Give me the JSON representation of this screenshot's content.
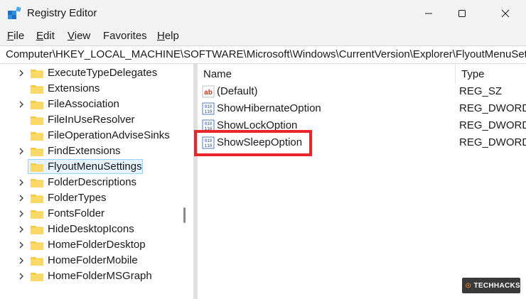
{
  "window": {
    "title": "Registry Editor",
    "app_icon": "registry-cubes-icon",
    "controls": [
      "minimize-icon",
      "maximize-icon",
      "close-icon"
    ]
  },
  "menu": [
    {
      "label": "File",
      "mnemonic": "F",
      "rest": "ile"
    },
    {
      "label": "Edit",
      "mnemonic": "E",
      "rest": "dit"
    },
    {
      "label": "View",
      "mnemonic": "V",
      "rest": "iew"
    },
    {
      "label": "Favorites",
      "mnemonic": "",
      "rest": "Favorites"
    },
    {
      "label": "Help",
      "mnemonic": "H",
      "rest": "elp"
    }
  ],
  "address": "Computer\\HKEY_LOCAL_MACHINE\\SOFTWARE\\Microsoft\\Windows\\CurrentVersion\\Explorer\\FlyoutMenuSettin",
  "tree": {
    "items": [
      {
        "label": "ExecuteTypeDelegates",
        "expandable": true
      },
      {
        "label": "Extensions",
        "expandable": false
      },
      {
        "label": "FileAssociation",
        "expandable": true
      },
      {
        "label": "FileInUseResolver",
        "expandable": false
      },
      {
        "label": "FileOperationAdviseSinks",
        "expandable": false
      },
      {
        "label": "FindExtensions",
        "expandable": true
      },
      {
        "label": "FlyoutMenuSettings",
        "expandable": false,
        "selected": true
      },
      {
        "label": "FolderDescriptions",
        "expandable": true
      },
      {
        "label": "FolderTypes",
        "expandable": true
      },
      {
        "label": "FontsFolder",
        "expandable": true
      },
      {
        "label": "HideDesktopIcons",
        "expandable": true
      },
      {
        "label": "HomeFolderDesktop",
        "expandable": true
      },
      {
        "label": "HomeFolderMobile",
        "expandable": true
      },
      {
        "label": "HomeFolderMSGraph",
        "expandable": true
      }
    ]
  },
  "values": {
    "columns": {
      "name": "Name",
      "type": "Type"
    },
    "rows": [
      {
        "name": "(Default)",
        "type": "REG_SZ",
        "icon": "string-value-icon"
      },
      {
        "name": "ShowHibernateOption",
        "type": "REG_DWORD",
        "icon": "binary-value-icon"
      },
      {
        "name": "ShowLockOption",
        "type": "REG_DWORD",
        "icon": "binary-value-icon"
      },
      {
        "name": "ShowSleepOption",
        "type": "REG_DWORD",
        "icon": "binary-value-icon",
        "highlighted": true
      }
    ]
  },
  "watermark": {
    "text": "TECHHACKS"
  },
  "colors": {
    "highlight": "#e8272c",
    "folder": "#f6c945",
    "selection_bg": "#e5f3ff",
    "selection_border": "#99d1ff"
  }
}
